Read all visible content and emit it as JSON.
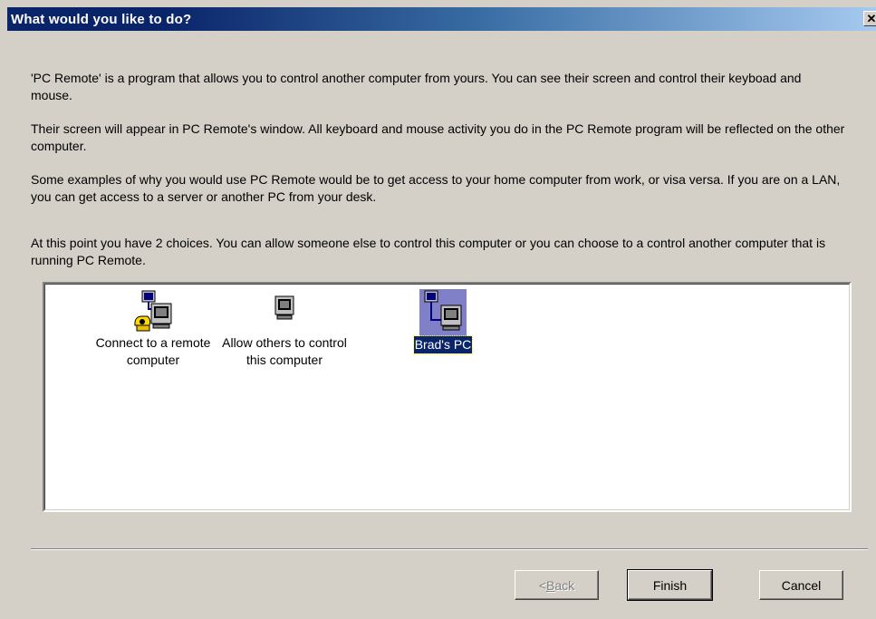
{
  "window": {
    "title": "What would you like to do?",
    "close_glyph": "✕"
  },
  "intro": {
    "p1": "'PC Remote' is a program that allows you to control another computer from yours.  You can see their screen and control their keyboad and mouse.",
    "p2": "Their screen will appear in PC Remote's window.  All keyboard and mouse activity you do in the PC Remote program will be reflected on the other computer.",
    "p3": "Some examples of why you would use PC Remote would be to get access to your home computer from work, or visa versa.  If you are on a LAN, you can get access to a server or another PC from your desk.",
    "p4": "At this point you have 2 choices.  You can allow someone else to control this computer or you can choose to a control another computer that is running PC Remote."
  },
  "choices": [
    {
      "label_line1": "Connect to a remote",
      "label_line2": "computer",
      "icon": "computer-phone-icon",
      "selected": false
    },
    {
      "label_line1": "Allow others to control",
      "label_line2": "this computer",
      "icon": "computer-icon",
      "selected": false
    },
    {
      "label_line1": "Brad's PC",
      "label_line2": "",
      "icon": "networked-computer-icon",
      "selected": true
    }
  ],
  "buttons": {
    "back_prefix": "< ",
    "back_access": "B",
    "back_rest": "ack",
    "finish": "Finish",
    "cancel": "Cancel"
  },
  "colors": {
    "title_active": "#0a246a",
    "selection": "#0a246a",
    "dialog_face": "#d4d0c8"
  }
}
